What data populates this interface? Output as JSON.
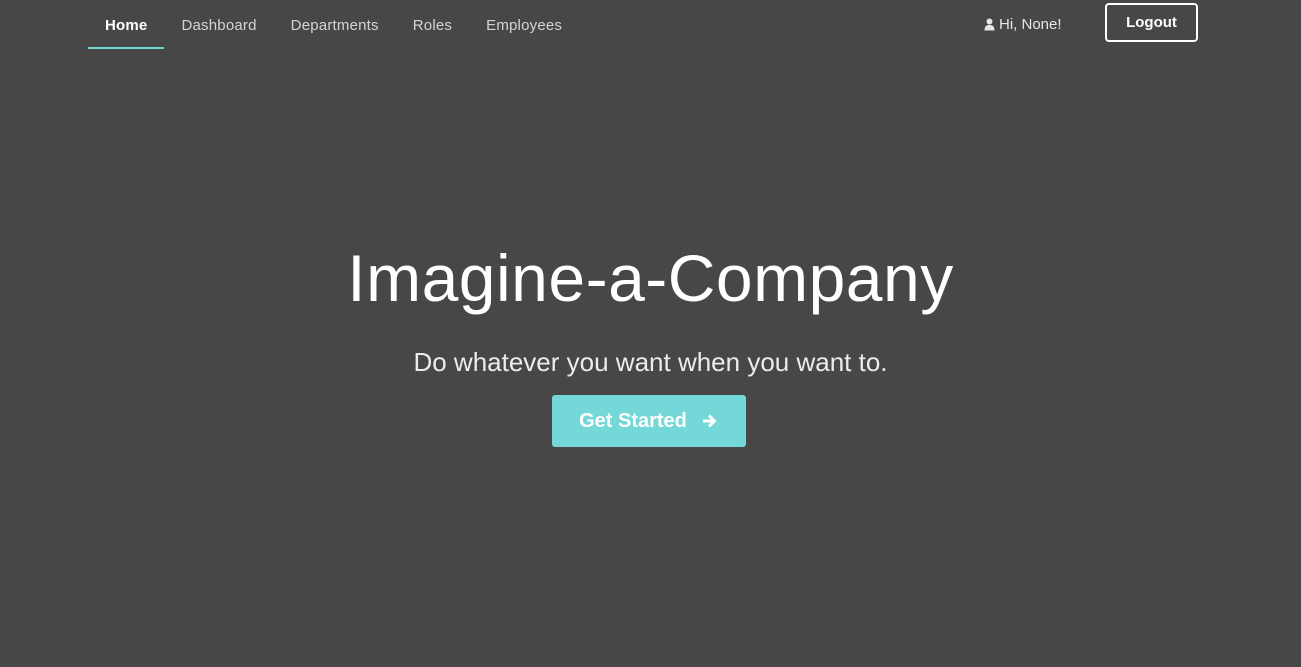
{
  "nav": {
    "tabs": [
      {
        "label": "Home",
        "active": true
      },
      {
        "label": "Dashboard",
        "active": false
      },
      {
        "label": "Departments",
        "active": false
      },
      {
        "label": "Roles",
        "active": false
      },
      {
        "label": "Employees",
        "active": false
      }
    ],
    "greeting": "Hi, None!",
    "user_icon": "user-icon",
    "logout_label": "Logout"
  },
  "hero": {
    "title": "Imagine-a-Company",
    "subtitle": "Do whatever you want when you want to.",
    "cta_label": "Get Started",
    "cta_icon": "arrow-right-icon"
  },
  "colors": {
    "background": "#474747",
    "accent": "#74d8d8",
    "text": "#ffffff"
  }
}
